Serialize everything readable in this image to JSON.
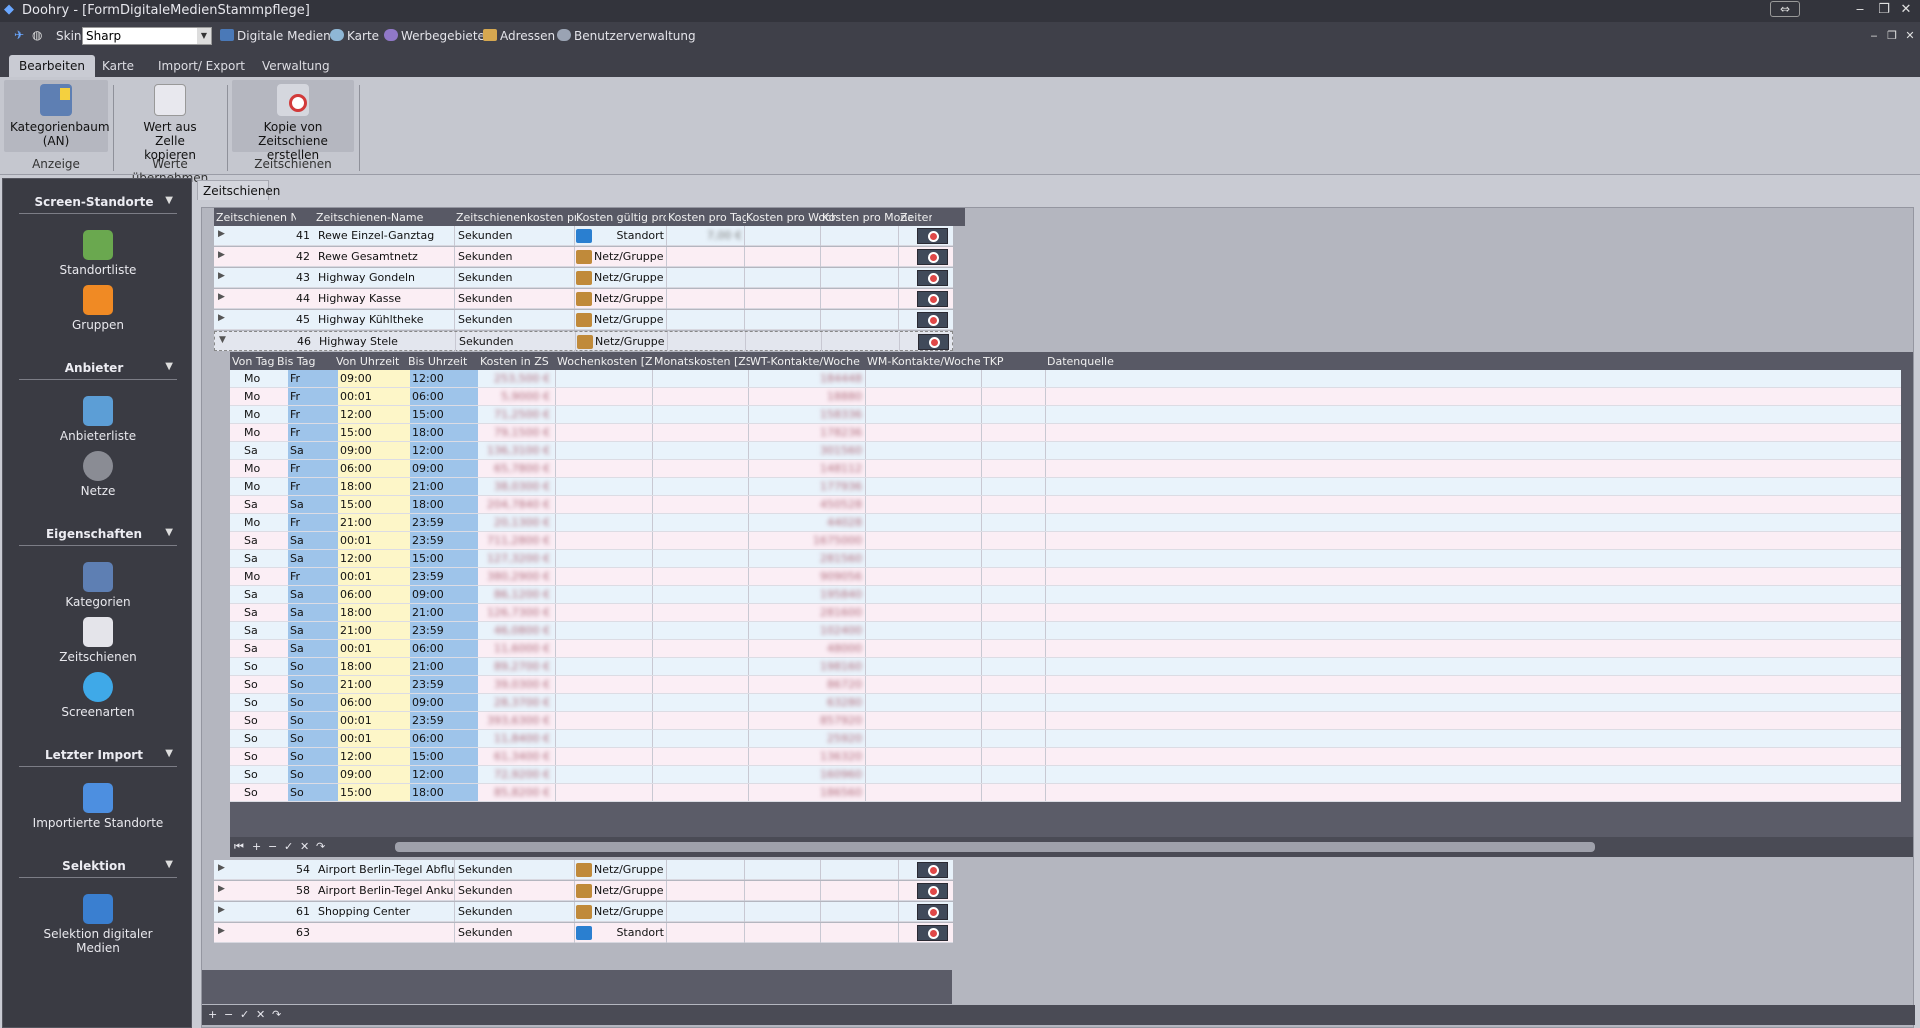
{
  "window": {
    "title": "Doohry - [FormDigitaleMedienStammpflege]"
  },
  "menubar": {
    "skin_label": "Skin",
    "skin_value": "Sharp",
    "items": [
      "Digitale Medien",
      "Karte",
      "Werbegebiete",
      "Adressen",
      "Benutzerverwaltung"
    ]
  },
  "ribbon_tabs": [
    "Bearbeiten",
    "Karte",
    "Import/ Export",
    "Verwaltung"
  ],
  "ribbon": {
    "buttons": [
      "Kategorienbaum (AN)",
      "Wert aus Zelle kopieren",
      "Kopie von Zeitschiene erstellen"
    ],
    "groups": [
      "Anzeige",
      "Werte übernehmen",
      "Zeitschienen"
    ]
  },
  "sidebar": {
    "sections": [
      {
        "title": "Screen-Standorte",
        "items": [
          "Standortliste",
          "Gruppen"
        ]
      },
      {
        "title": "Anbieter",
        "items": [
          "Anbieterliste",
          "Netze"
        ]
      },
      {
        "title": "Eigenschaften",
        "items": [
          "Kategorien",
          "Zeitschienen",
          "Screenarten"
        ]
      },
      {
        "title": "Letzter Import",
        "items": [
          "Importierte Standorte"
        ]
      },
      {
        "title": "Selektion",
        "items": [
          "Selektion digitaler Medien"
        ]
      }
    ]
  },
  "doc_tab": "Zeitschienen",
  "master": {
    "columns": [
      "Zeitschienen Nr.",
      "Zeitschienen-Name",
      "Zeitschienenkosten pro",
      "Kosten gültig pro",
      "Kosten pro Tag",
      "Kosten pro Woche",
      "Kosten pro Monat",
      "Zeiten"
    ],
    "rows_top": [
      {
        "nr": "41",
        "name": "Rewe Einzel-Ganztag",
        "unit": "Sekunden",
        "scope": "Standort",
        "tag": "7,00 €"
      },
      {
        "nr": "42",
        "name": "Rewe Gesamtnetz",
        "unit": "Sekunden",
        "scope": "Netz/Gruppe",
        "tag": ""
      },
      {
        "nr": "43",
        "name": "Highway Gondeln",
        "unit": "Sekunden",
        "scope": "Netz/Gruppe",
        "tag": ""
      },
      {
        "nr": "44",
        "name": "Highway Kasse",
        "unit": "Sekunden",
        "scope": "Netz/Gruppe",
        "tag": ""
      },
      {
        "nr": "45",
        "name": "Highway Kühltheke",
        "unit": "Sekunden",
        "scope": "Netz/Gruppe",
        "tag": ""
      },
      {
        "nr": "46",
        "name": "Highway Stele",
        "unit": "Sekunden",
        "scope": "Netz/Gruppe",
        "tag": ""
      }
    ],
    "rows_bottom": [
      {
        "nr": "54",
        "name": "Airport Berlin-Tegel Abflug",
        "unit": "Sekunden",
        "scope": "Netz/Gruppe"
      },
      {
        "nr": "58",
        "name": "Airport Berlin-Tegel Ankunft",
        "unit": "Sekunden",
        "scope": "Netz/Gruppe"
      },
      {
        "nr": "61",
        "name": "Shopping Center",
        "unit": "Sekunden",
        "scope": "Netz/Gruppe"
      },
      {
        "nr": "63",
        "name": "",
        "unit": "Sekunden",
        "scope": "Standort"
      }
    ]
  },
  "detail": {
    "columns": [
      "Von Tag",
      "Bis Tag",
      "Von Uhrzeit",
      "Bis Uhrzeit",
      "Kosten in ZS",
      "Wochenkosten [ZS]",
      "Monatskosten [ZS]",
      "WT-Kontakte/Woche",
      "WM-Kontakte/Woche",
      "TKP",
      "Datenquelle"
    ],
    "rows": [
      {
        "von": "Mo",
        "bis": "Fr",
        "vu": "09:00",
        "bu": "12:00",
        "k": "253,500 €",
        "wt": "184448"
      },
      {
        "von": "Mo",
        "bis": "Fr",
        "vu": "00:01",
        "bu": "06:00",
        "k": "5,9000 €",
        "wt": "18880"
      },
      {
        "von": "Mo",
        "bis": "Fr",
        "vu": "12:00",
        "bu": "15:00",
        "k": "71,2500 €",
        "wt": "158336"
      },
      {
        "von": "Mo",
        "bis": "Fr",
        "vu": "15:00",
        "bu": "18:00",
        "k": "79,1500 €",
        "wt": "178236"
      },
      {
        "von": "Sa",
        "bis": "Sa",
        "vu": "09:00",
        "bu": "12:00",
        "k": "136,3100 €",
        "wt": "301560"
      },
      {
        "von": "Mo",
        "bis": "Fr",
        "vu": "06:00",
        "bu": "09:00",
        "k": "65,7800 €",
        "wt": "148112"
      },
      {
        "von": "Mo",
        "bis": "Fr",
        "vu": "18:00",
        "bu": "21:00",
        "k": "38,0300 €",
        "wt": "177936"
      },
      {
        "von": "Sa",
        "bis": "Sa",
        "vu": "15:00",
        "bu": "18:00",
        "k": "204,7840 €",
        "wt": "450528"
      },
      {
        "von": "Mo",
        "bis": "Fr",
        "vu": "21:00",
        "bu": "23:59",
        "k": "20,1300 €",
        "wt": "44028"
      },
      {
        "von": "Sa",
        "bis": "Sa",
        "vu": "00:01",
        "bu": "23:59",
        "k": "711,2800 €",
        "wt": "1675000"
      },
      {
        "von": "Sa",
        "bis": "Sa",
        "vu": "12:00",
        "bu": "15:00",
        "k": "127,3200 €",
        "wt": "281560"
      },
      {
        "von": "Mo",
        "bis": "Fr",
        "vu": "00:01",
        "bu": "23:59",
        "k": "380,2900 €",
        "wt": "909056"
      },
      {
        "von": "Sa",
        "bis": "Sa",
        "vu": "06:00",
        "bu": "09:00",
        "k": "86,1200 €",
        "wt": "195840"
      },
      {
        "von": "Sa",
        "bis": "Sa",
        "vu": "18:00",
        "bu": "21:00",
        "k": "126,7300 €",
        "wt": "281600"
      },
      {
        "von": "Sa",
        "bis": "Sa",
        "vu": "21:00",
        "bu": "23:59",
        "k": "46,0800 €",
        "wt": "102400"
      },
      {
        "von": "Sa",
        "bis": "Sa",
        "vu": "00:01",
        "bu": "06:00",
        "k": "11,6000 €",
        "wt": "48000"
      },
      {
        "von": "So",
        "bis": "So",
        "vu": "18:00",
        "bu": "21:00",
        "k": "89,2700 €",
        "wt": "198160"
      },
      {
        "von": "So",
        "bis": "So",
        "vu": "21:00",
        "bu": "23:59",
        "k": "39,0300 €",
        "wt": "86720"
      },
      {
        "von": "So",
        "bis": "So",
        "vu": "06:00",
        "bu": "09:00",
        "k": "28,3700 €",
        "wt": "63280"
      },
      {
        "von": "So",
        "bis": "So",
        "vu": "00:01",
        "bu": "23:59",
        "k": "393,6300 €",
        "wt": "857920"
      },
      {
        "von": "So",
        "bis": "So",
        "vu": "00:01",
        "bu": "06:00",
        "k": "11,8400 €",
        "wt": "25920"
      },
      {
        "von": "So",
        "bis": "So",
        "vu": "12:00",
        "bu": "15:00",
        "k": "61,3400 €",
        "wt": "136320"
      },
      {
        "von": "So",
        "bis": "So",
        "vu": "09:00",
        "bu": "12:00",
        "k": "72,9200 €",
        "wt": "160960"
      },
      {
        "von": "So",
        "bis": "So",
        "vu": "15:00",
        "bu": "18:00",
        "k": "85,8200 €",
        "wt": "186560"
      }
    ]
  }
}
